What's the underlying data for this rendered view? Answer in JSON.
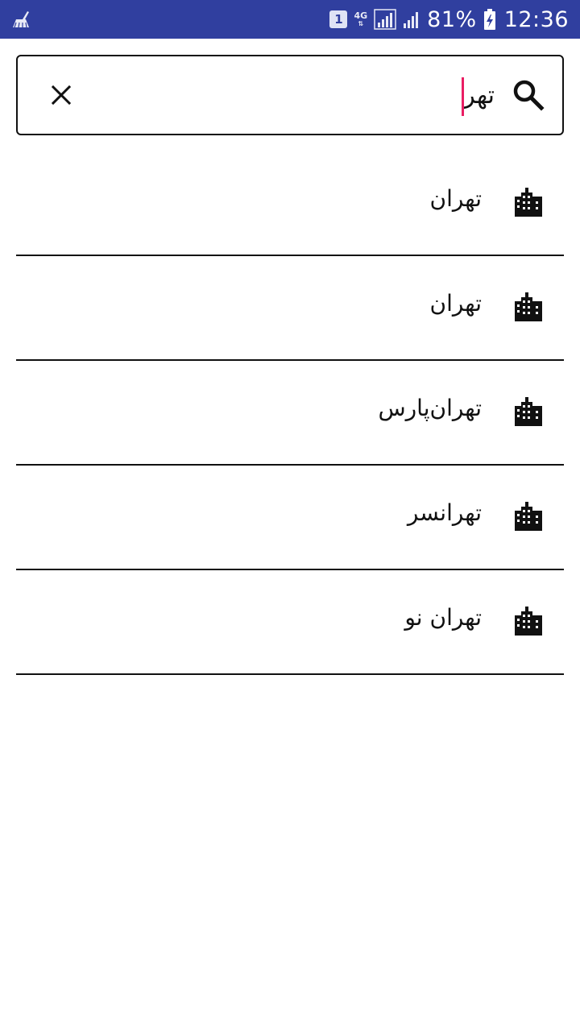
{
  "status_bar": {
    "sim_slot": "1",
    "network": "4G",
    "battery": "81%",
    "time": "12:36",
    "icons": [
      "cleaner-icon",
      "sim-icon",
      "network-4g-icon",
      "signal-icon",
      "signal-icon",
      "battery-charging-icon"
    ]
  },
  "search": {
    "value": "تهر",
    "icon": "search-icon",
    "clear_icon": "close-icon",
    "caret_color": "#e91e63"
  },
  "results": [
    {
      "label": "تهران",
      "icon": "city-icon"
    },
    {
      "label": "تهران",
      "icon": "city-icon"
    },
    {
      "label": "تهران‌پارس",
      "icon": "city-icon"
    },
    {
      "label": "تهرانسر",
      "icon": "city-icon"
    },
    {
      "label": "تهران نو",
      "icon": "city-icon"
    }
  ],
  "colors": {
    "status_bar": "#303f9f",
    "accent": "#e91e63",
    "text": "#111111"
  }
}
